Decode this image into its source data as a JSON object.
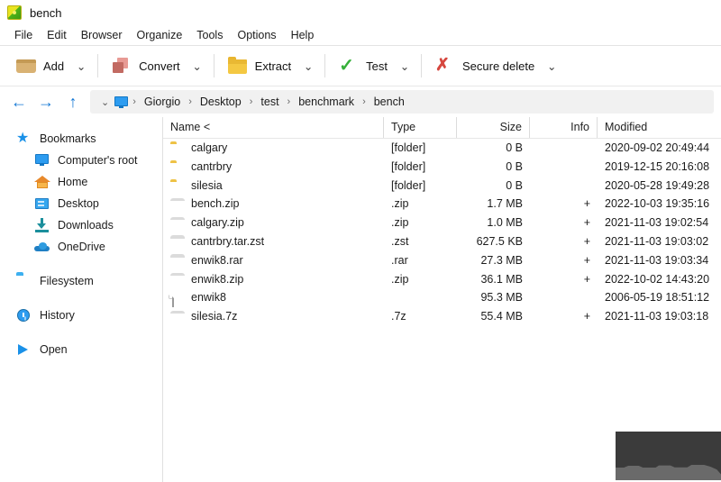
{
  "window": {
    "title": "bench",
    "logo_icon": "peazip-logo-icon"
  },
  "menubar": {
    "items": [
      {
        "label": "File"
      },
      {
        "label": "Edit"
      },
      {
        "label": "Browser"
      },
      {
        "label": "Organize"
      },
      {
        "label": "Tools"
      },
      {
        "label": "Options"
      },
      {
        "label": "Help"
      }
    ]
  },
  "toolbar": {
    "buttons": [
      {
        "label": "Add",
        "icon": "archive-box-icon",
        "has_dropdown": true
      },
      {
        "label": "Convert",
        "icon": "convert-squares-icon",
        "has_dropdown": true
      },
      {
        "label": "Extract",
        "icon": "folder-icon",
        "has_dropdown": true
      },
      {
        "label": "Test",
        "icon": "green-check-icon",
        "has_dropdown": true
      },
      {
        "label": "Secure delete",
        "icon": "red-cross-icon",
        "has_dropdown": true
      }
    ],
    "dropdown_glyph": "⌄"
  },
  "navbar": {
    "back_icon": "arrow-left-icon",
    "back_glyph": "←",
    "forward_icon": "arrow-right-icon",
    "forward_glyph": "→",
    "up_icon": "arrow-up-icon",
    "up_glyph": "↑",
    "history_caret_glyph": "⌄",
    "root_icon": "computer-monitor-icon",
    "separator_glyph": "›",
    "breadcrumbs": [
      {
        "label": "Giorgio"
      },
      {
        "label": "Desktop"
      },
      {
        "label": "test"
      },
      {
        "label": "benchmark"
      },
      {
        "label": "bench"
      }
    ]
  },
  "sidebar": {
    "groups": [
      {
        "header": {
          "label": "Bookmarks",
          "icon": "star-icon"
        },
        "items": [
          {
            "label": "Computer's root",
            "icon": "computer-monitor-icon"
          },
          {
            "label": "Home",
            "icon": "home-icon"
          },
          {
            "label": "Desktop",
            "icon": "desktop-icon"
          },
          {
            "label": "Downloads",
            "icon": "download-icon"
          },
          {
            "label": "OneDrive",
            "icon": "cloud-icon"
          }
        ]
      },
      {
        "header": {
          "label": "Filesystem",
          "icon": "blue-folder-icon"
        },
        "items": []
      },
      {
        "header": {
          "label": "History",
          "icon": "clock-history-icon"
        },
        "items": []
      },
      {
        "header": {
          "label": "Open",
          "icon": "play-triangle-icon"
        },
        "items": []
      }
    ]
  },
  "filelist": {
    "columns": [
      {
        "key": "name",
        "label": "Name <"
      },
      {
        "key": "type",
        "label": "Type"
      },
      {
        "key": "size",
        "label": "Size"
      },
      {
        "key": "info",
        "label": "Info"
      },
      {
        "key": "modified",
        "label": "Modified"
      }
    ],
    "sort": {
      "column": "Name",
      "glyph": "<"
    },
    "rows": [
      {
        "name": "calgary",
        "icon": "folder-icon",
        "icon_color": "#f6cf5c",
        "type": "[folder]",
        "size": "0 B",
        "info": "",
        "modified": "2020-09-02 20:49:44"
      },
      {
        "name": "cantrbry",
        "icon": "folder-icon",
        "icon_color": "#f6cf5c",
        "type": "[folder]",
        "size": "0 B",
        "info": "",
        "modified": "2019-12-15 20:16:08"
      },
      {
        "name": "silesia",
        "icon": "folder-icon",
        "icon_color": "#f6cf5c",
        "type": "[folder]",
        "size": "0 B",
        "info": "",
        "modified": "2020-05-28 19:49:28"
      },
      {
        "name": "bench.zip",
        "icon": "zip-archive-icon",
        "icon_color": "#e8b521",
        "type": ".zip",
        "size": "1.7 MB",
        "info": "+",
        "modified": "2022-10-03 19:35:16"
      },
      {
        "name": "calgary.zip",
        "icon": "zip-archive-icon",
        "icon_color": "#e8b521",
        "type": ".zip",
        "size": "1.0 MB",
        "info": "+",
        "modified": "2021-11-03 19:02:54"
      },
      {
        "name": "cantrbry.tar.zst",
        "icon": "zst-archive-icon",
        "icon_color": "#dbb57a",
        "type": ".zst",
        "size": "627.5 KB",
        "info": "+",
        "modified": "2021-11-03 19:03:02"
      },
      {
        "name": "enwik8.rar",
        "icon": "rar-archive-icon",
        "icon_color": "#5b92bb",
        "type": ".rar",
        "size": "27.3 MB",
        "info": "+",
        "modified": "2021-11-03 19:03:34"
      },
      {
        "name": "enwik8.zip",
        "icon": "zip-archive-icon",
        "icon_color": "#e8b521",
        "type": ".zip",
        "size": "36.1 MB",
        "info": "+",
        "modified": "2022-10-02 14:43:20"
      },
      {
        "name": "enwik8",
        "icon": "plain-file-icon",
        "icon_color": "#fdfdfd",
        "type": "",
        "size": "95.3 MB",
        "info": "",
        "modified": "2006-05-19 18:51:12"
      },
      {
        "name": "silesia.7z",
        "icon": "7z-archive-icon",
        "icon_color": "#b8bd28",
        "type": ".7z",
        "size": "55.4 MB",
        "info": "+",
        "modified": "2021-11-03 19:03:18"
      }
    ]
  },
  "colors": {
    "accent": "#1277d4",
    "folder": "#f6cf5c",
    "test_green": "#36b03a",
    "delete_red": "#d6473f",
    "overlay_dark": "#3b3b3b",
    "overlay_light": "#6a6a6a"
  }
}
